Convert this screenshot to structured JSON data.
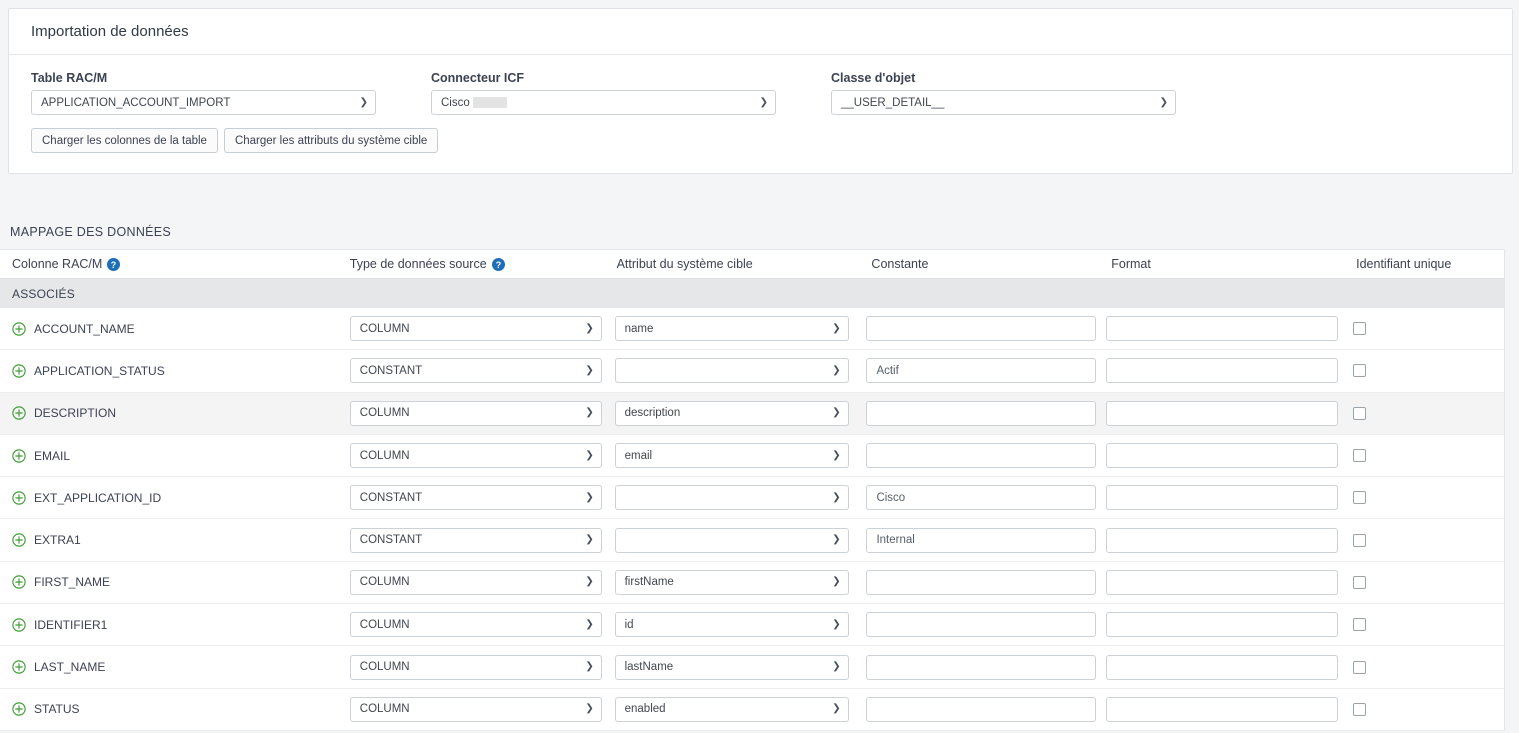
{
  "panel": {
    "title": "Importation de données",
    "fields": [
      {
        "label": "Table RAC/M",
        "value": "APPLICATION_ACCOUNT_IMPORT",
        "redacted": false
      },
      {
        "label": "Connecteur ICF",
        "value": "Cisco",
        "redacted": true
      },
      {
        "label": "Classe d'objet",
        "value": "__USER_DETAIL__",
        "redacted": false
      }
    ],
    "buttons": [
      {
        "label": "Charger les colonnes de la table"
      },
      {
        "label": "Charger les attributs du système cible"
      }
    ]
  },
  "mapping": {
    "section_title": "MAPPAGE DES DONNÉES",
    "columns": {
      "name": "Colonne RAC/M",
      "type": "Type de données source",
      "attribute": "Attribut du système cible",
      "constant": "Constante",
      "format": "Format",
      "unique": "Identifiant unique"
    },
    "group_label": "ASSOCIÉS",
    "icons": {
      "help": "help-circle-icon",
      "add": "plus-circle-icon",
      "chevron": "chevron-down-icon"
    },
    "colors": {
      "help": "#1e6fb8",
      "add": "#3f9c35",
      "group_bg": "#e6e7e8",
      "alt_row_bg": "#f4f4f5"
    },
    "rows": [
      {
        "name": "ACCOUNT_NAME",
        "type": "COLUMN",
        "attribute": "name",
        "constant": "",
        "format": "",
        "unique": false
      },
      {
        "name": "APPLICATION_STATUS",
        "type": "CONSTANT",
        "attribute": "",
        "constant": "Actif",
        "format": "",
        "unique": false
      },
      {
        "name": "DESCRIPTION",
        "type": "COLUMN",
        "attribute": "description",
        "constant": "",
        "format": "",
        "unique": false
      },
      {
        "name": "EMAIL",
        "type": "COLUMN",
        "attribute": "email",
        "constant": "",
        "format": "",
        "unique": false
      },
      {
        "name": "EXT_APPLICATION_ID",
        "type": "CONSTANT",
        "attribute": "",
        "constant": "Cisco",
        "format": "",
        "unique": false
      },
      {
        "name": "EXTRA1",
        "type": "CONSTANT",
        "attribute": "",
        "constant": "Internal",
        "format": "",
        "unique": false
      },
      {
        "name": "FIRST_NAME",
        "type": "COLUMN",
        "attribute": "firstName",
        "constant": "",
        "format": "",
        "unique": false
      },
      {
        "name": "IDENTIFIER1",
        "type": "COLUMN",
        "attribute": "id",
        "constant": "",
        "format": "",
        "unique": false
      },
      {
        "name": "LAST_NAME",
        "type": "COLUMN",
        "attribute": "lastName",
        "constant": "",
        "format": "",
        "unique": false
      },
      {
        "name": "STATUS",
        "type": "COLUMN",
        "attribute": "enabled",
        "constant": "",
        "format": "",
        "unique": false
      }
    ]
  }
}
